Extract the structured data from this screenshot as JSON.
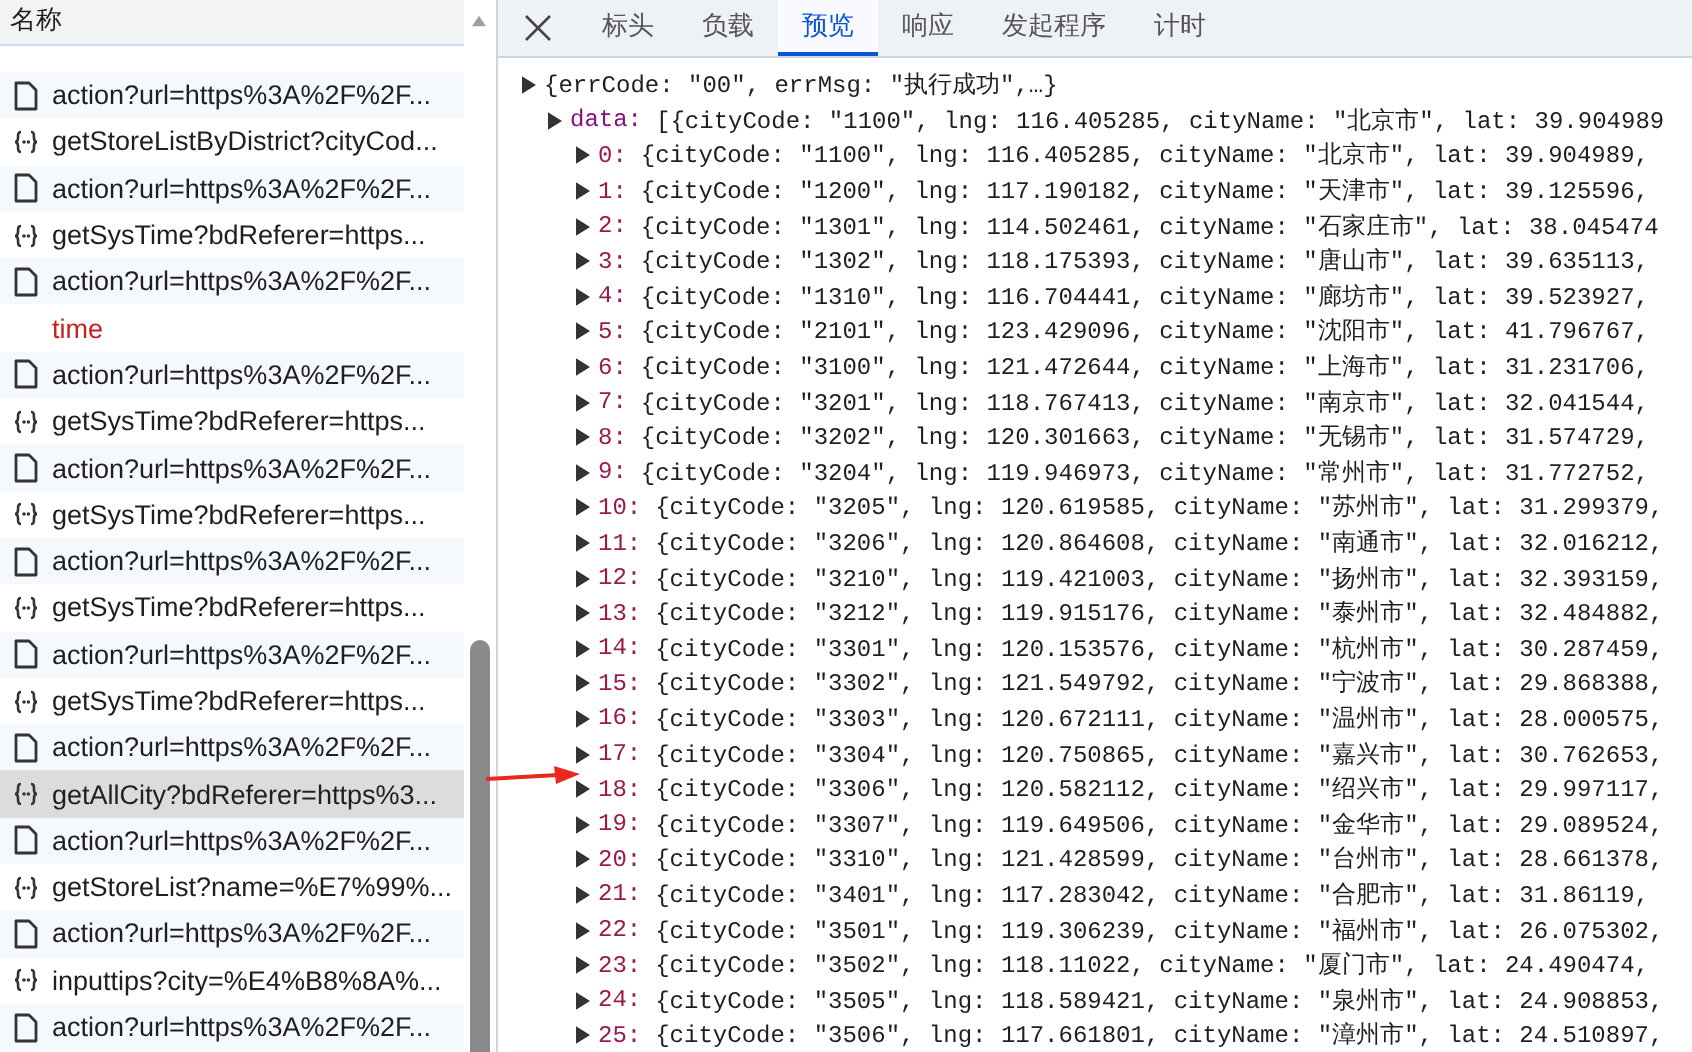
{
  "sidebar": {
    "header": "名称",
    "items": [
      {
        "kind": "doc",
        "name": "action?url=https%3A%2F%2F...",
        "selected": false
      },
      {
        "kind": "fetch",
        "name": "getStoreListByDistrict?cityCod...",
        "selected": false
      },
      {
        "kind": "doc",
        "name": "action?url=https%3A%2F%2F...",
        "selected": false
      },
      {
        "kind": "fetch",
        "name": "getSysTime?bdReferer=https...",
        "selected": false
      },
      {
        "kind": "doc",
        "name": "action?url=https%3A%2F%2F...",
        "selected": false
      },
      {
        "kind": "plain",
        "name": "time",
        "selected": false
      },
      {
        "kind": "doc",
        "name": "action?url=https%3A%2F%2F...",
        "selected": false
      },
      {
        "kind": "fetch",
        "name": "getSysTime?bdReferer=https...",
        "selected": false
      },
      {
        "kind": "doc",
        "name": "action?url=https%3A%2F%2F...",
        "selected": false
      },
      {
        "kind": "fetch",
        "name": "getSysTime?bdReferer=https...",
        "selected": false
      },
      {
        "kind": "doc",
        "name": "action?url=https%3A%2F%2F...",
        "selected": false
      },
      {
        "kind": "fetch",
        "name": "getSysTime?bdReferer=https...",
        "selected": false
      },
      {
        "kind": "doc",
        "name": "action?url=https%3A%2F%2F...",
        "selected": false
      },
      {
        "kind": "fetch",
        "name": "getSysTime?bdReferer=https...",
        "selected": false
      },
      {
        "kind": "doc",
        "name": "action?url=https%3A%2F%2F...",
        "selected": false
      },
      {
        "kind": "fetch",
        "name": "getAllCity?bdReferer=https%3...",
        "selected": true
      },
      {
        "kind": "doc",
        "name": "action?url=https%3A%2F%2F...",
        "selected": false
      },
      {
        "kind": "fetch",
        "name": "getStoreList?name=%E7%99%...",
        "selected": false
      },
      {
        "kind": "doc",
        "name": "action?url=https%3A%2F%2F...",
        "selected": false
      },
      {
        "kind": "fetch",
        "name": "inputtips?city=%E4%B8%8A%...",
        "selected": false
      },
      {
        "kind": "doc",
        "name": "action?url=https%3A%2F%2F...",
        "selected": false
      }
    ]
  },
  "tabs": [
    {
      "label": "标头",
      "selected": false
    },
    {
      "label": "负载",
      "selected": false
    },
    {
      "label": "预览",
      "selected": true
    },
    {
      "label": "响应",
      "selected": false
    },
    {
      "label": "发起程序",
      "selected": false
    },
    {
      "label": "计时",
      "selected": false
    }
  ],
  "preview": {
    "root": "{errCode: \"00\", errMsg: \"执行成功\",…}",
    "data": {
      "key": "data:",
      "text": "[{cityCode: \"1100\", lng: 116.405285, cityName: \"北京市\", lat: 39.904989"
    },
    "items": [
      {
        "index": "0:",
        "text": "{cityCode: \"1100\", lng: 116.405285, cityName: \"北京市\", lat: 39.904989,"
      },
      {
        "index": "1:",
        "text": "{cityCode: \"1200\", lng: 117.190182, cityName: \"天津市\", lat: 39.125596,"
      },
      {
        "index": "2:",
        "text": "{cityCode: \"1301\", lng: 114.502461, cityName: \"石家庄市\", lat: 38.045474"
      },
      {
        "index": "3:",
        "text": "{cityCode: \"1302\", lng: 118.175393, cityName: \"唐山市\", lat: 39.635113,"
      },
      {
        "index": "4:",
        "text": "{cityCode: \"1310\", lng: 116.704441, cityName: \"廊坊市\", lat: 39.523927,"
      },
      {
        "index": "5:",
        "text": "{cityCode: \"2101\", lng: 123.429096, cityName: \"沈阳市\", lat: 41.796767,"
      },
      {
        "index": "6:",
        "text": "{cityCode: \"3100\", lng: 121.472644, cityName: \"上海市\", lat: 31.231706,"
      },
      {
        "index": "7:",
        "text": "{cityCode: \"3201\", lng: 118.767413, cityName: \"南京市\", lat: 32.041544,"
      },
      {
        "index": "8:",
        "text": "{cityCode: \"3202\", lng: 120.301663, cityName: \"无锡市\", lat: 31.574729,"
      },
      {
        "index": "9:",
        "text": "{cityCode: \"3204\", lng: 119.946973, cityName: \"常州市\", lat: 31.772752,"
      },
      {
        "index": "10:",
        "text": "{cityCode: \"3205\", lng: 120.619585, cityName: \"苏州市\", lat: 31.299379,"
      },
      {
        "index": "11:",
        "text": "{cityCode: \"3206\", lng: 120.864608, cityName: \"南通市\", lat: 32.016212,"
      },
      {
        "index": "12:",
        "text": "{cityCode: \"3210\", lng: 119.421003, cityName: \"扬州市\", lat: 32.393159,"
      },
      {
        "index": "13:",
        "text": "{cityCode: \"3212\", lng: 119.915176, cityName: \"泰州市\", lat: 32.484882,"
      },
      {
        "index": "14:",
        "text": "{cityCode: \"3301\", lng: 120.153576, cityName: \"杭州市\", lat: 30.287459,"
      },
      {
        "index": "15:",
        "text": "{cityCode: \"3302\", lng: 121.549792, cityName: \"宁波市\", lat: 29.868388,"
      },
      {
        "index": "16:",
        "text": "{cityCode: \"3303\", lng: 120.672111, cityName: \"温州市\", lat: 28.000575,"
      },
      {
        "index": "17:",
        "text": "{cityCode: \"3304\", lng: 120.750865, cityName: \"嘉兴市\", lat: 30.762653,"
      },
      {
        "index": "18:",
        "text": "{cityCode: \"3306\", lng: 120.582112, cityName: \"绍兴市\", lat: 29.997117,"
      },
      {
        "index": "19:",
        "text": "{cityCode: \"3307\", lng: 119.649506, cityName: \"金华市\", lat: 29.089524,"
      },
      {
        "index": "20:",
        "text": "{cityCode: \"3310\", lng: 121.428599, cityName: \"台州市\", lat: 28.661378,"
      },
      {
        "index": "21:",
        "text": "{cityCode: \"3401\", lng: 117.283042, cityName: \"合肥市\", lat: 31.86119,"
      },
      {
        "index": "22:",
        "text": "{cityCode: \"3501\", lng: 119.306239, cityName: \"福州市\", lat: 26.075302,"
      },
      {
        "index": "23:",
        "text": "{cityCode: \"3502\", lng: 118.11022, cityName: \"厦门市\", lat: 24.490474,"
      },
      {
        "index": "24:",
        "text": "{cityCode: \"3505\", lng: 118.589421, cityName: \"泉州市\", lat: 24.908853,"
      },
      {
        "index": "25:",
        "text": "{cityCode: \"3506\", lng: 117.661801, cityName: \"漳州市\", lat: 24.510897,"
      }
    ]
  }
}
